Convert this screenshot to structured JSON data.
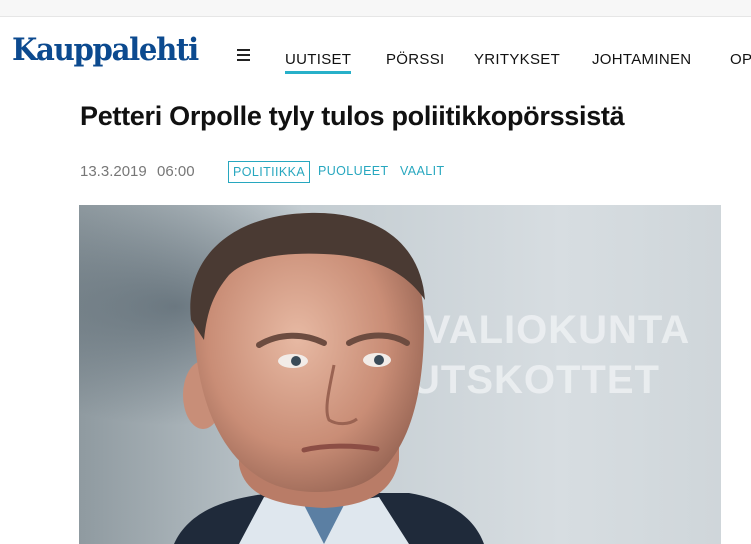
{
  "site": {
    "logo_text": "Kauppalehti",
    "brand_color": "#0c4a8f",
    "accent_color": "#27b0c9"
  },
  "nav": {
    "menu_icon": "hamburger-menu-icon",
    "items": [
      {
        "label": "UUTISET",
        "active": true
      },
      {
        "label": "PÖRSSI",
        "active": false
      },
      {
        "label": "YRITYKSET",
        "active": false
      },
      {
        "label": "JOHTAMINEN",
        "active": false
      },
      {
        "label": "OP",
        "active": false
      }
    ]
  },
  "article": {
    "title": "Petteri Orpolle tyly tulos poliitikkopörssistä",
    "date": "13.3.2019",
    "time": "06:00",
    "tags": [
      {
        "label": "POLITIIKKA",
        "boxed": true
      },
      {
        "label": "PUOLUEET",
        "boxed": false
      },
      {
        "label": "VAALIT",
        "boxed": false
      }
    ],
    "image": {
      "background_sign_line1": "VALIOKUNTA",
      "background_sign_line2": "UTSKOTTET"
    }
  }
}
